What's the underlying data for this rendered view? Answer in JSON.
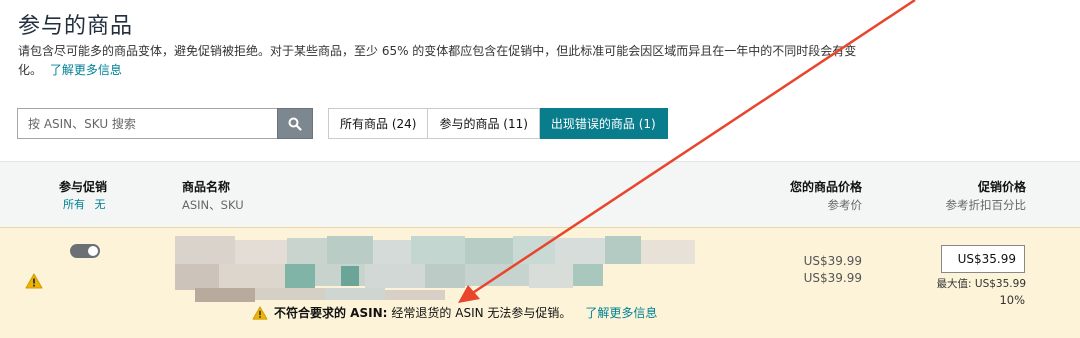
{
  "page": {
    "title": "参与的商品",
    "description": "请包含尽可能多的商品变体，避免促销被拒绝。对于某些商品，至少 65% 的变体都应包含在促销中，但此标准可能会因区域而异且在一年中的不同时段会有变化。",
    "learn_more": "了解更多信息"
  },
  "search": {
    "placeholder": "按 ASIN、SKU 搜索",
    "value": ""
  },
  "tabs": [
    {
      "label": "所有商品 (24)",
      "active": false
    },
    {
      "label": "参与的商品 (11)",
      "active": false
    },
    {
      "label": "出现错误的商品 (1)",
      "active": true
    }
  ],
  "table": {
    "col_participate": "参与促销",
    "filter_all": "所有",
    "filter_none": "无",
    "col_name": "商品名称",
    "col_name_sub": "ASIN、SKU",
    "col_price": "您的商品价格",
    "col_price_sub": "参考价",
    "col_promo": "促销价格",
    "col_promo_sub": "参考折扣百分比"
  },
  "row": {
    "price": "US$39.99",
    "ref_price": "US$39.99",
    "promo_price": "US$35.99",
    "max_label": "最大值: US$35.99",
    "discount_pct": "10%",
    "error_bold": "不符合要求的 ASIN:",
    "error_text": "经常退货的 ASIN 无法参与促销。",
    "error_link": "了解更多信息",
    "toggle_on": true
  },
  "colors": {
    "accent": "#0a7d8c",
    "warning": "#f0b400",
    "arrow": "#e8452c",
    "error_row_bg": "#fcf3d8"
  }
}
